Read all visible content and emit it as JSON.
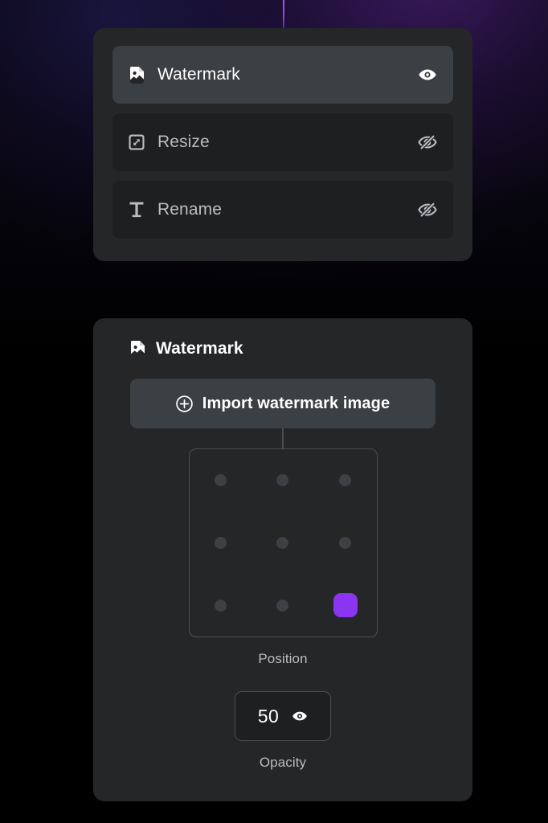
{
  "theme": {
    "background_top": "#0d0a18",
    "panel_bg": "#242628",
    "row_bg": "#1d1f21",
    "row_active_bg": "#3b4044",
    "accent_purple": "#8b35f2",
    "text_primary": "#ffffff",
    "text_secondary": "#b9bdc1",
    "border": "#4a4f53"
  },
  "steps_panel": {
    "name": "pipeline-steps",
    "items": [
      {
        "label": "Watermark",
        "icon": "image-file-icon",
        "active": true,
        "visible": true,
        "visibility_icon": "eye-icon"
      },
      {
        "label": "Resize",
        "icon": "resize-arrows-icon",
        "active": false,
        "visible": false,
        "visibility_icon": "eye-off-icon"
      },
      {
        "label": "Rename",
        "icon": "text-t-icon",
        "active": false,
        "visible": false,
        "visibility_icon": "eye-off-icon"
      }
    ]
  },
  "watermark_panel": {
    "title": "Watermark",
    "title_icon": "image-file-icon",
    "import_button": {
      "label": "Import watermark image",
      "icon": "plus-circle-icon"
    },
    "position": {
      "caption": "Position",
      "options": [
        "top-left",
        "top-center",
        "top-right",
        "middle-left",
        "middle-center",
        "middle-right",
        "bottom-left",
        "bottom-center",
        "bottom-right"
      ],
      "selected": "bottom-right",
      "selected_index": 8
    },
    "opacity": {
      "caption": "Opacity",
      "value": "50",
      "icon": "eye-icon"
    }
  }
}
